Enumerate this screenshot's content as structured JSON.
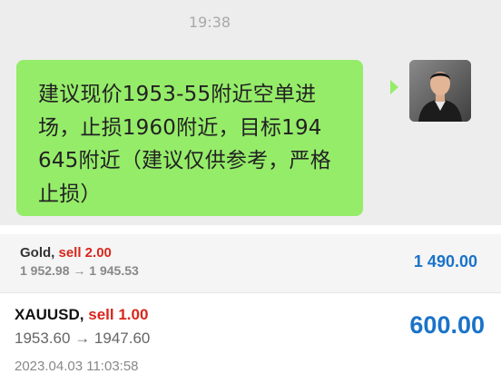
{
  "chat": {
    "timestamp": "19:38",
    "message": {
      "lines": [
        "建议现价1953-55附近空单进",
        "场，止损1960附近，目标194",
        "645附近（建议仅供参考，严格",
        "止损）"
      ]
    },
    "bubble_color": "#95ec69"
  },
  "trades": [
    {
      "symbol": "Gold,",
      "action": "sell 2.00",
      "open_price": "1 952.98",
      "arrow": "→",
      "close_price": "1 945.53",
      "profit": "1 490.00"
    },
    {
      "symbol": "XAUUSD,",
      "action": "sell 1.00",
      "open_price": "1953.60",
      "arrow": "→",
      "close_price": "1947.60",
      "profit": "600.00",
      "time": "2023.04.03 11:03:58"
    }
  ],
  "colors": {
    "sell": "#d9261c",
    "profit": "#1a73c9"
  },
  "icons": {
    "avatar": "user-avatar-photo"
  }
}
